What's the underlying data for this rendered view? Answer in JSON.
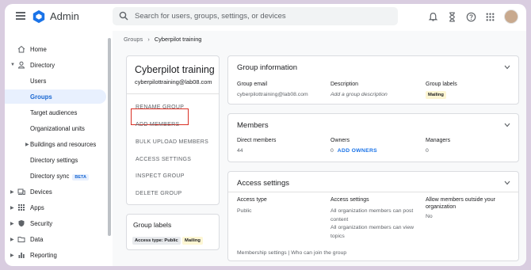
{
  "header": {
    "app_title": "Admin",
    "search_placeholder": "Search for users, groups, settings, or devices",
    "icons": [
      "menu-icon",
      "admin-logo-icon",
      "search-icon",
      "notifications-icon",
      "tasks-hourglass-icon",
      "help-icon",
      "apps-grid-icon",
      "avatar"
    ]
  },
  "sidebar": {
    "items": [
      {
        "label": "Home",
        "icon": "home-icon"
      },
      {
        "label": "Directory",
        "icon": "person-icon"
      },
      {
        "label": "Users"
      },
      {
        "label": "Groups",
        "active": true
      },
      {
        "label": "Target audiences"
      },
      {
        "label": "Organizational units"
      },
      {
        "label": "Buildings and resources"
      },
      {
        "label": "Directory settings"
      },
      {
        "label": "Directory sync",
        "badge": "BETA"
      },
      {
        "label": "Devices",
        "icon": "devices-icon"
      },
      {
        "label": "Apps",
        "icon": "apps-icon"
      },
      {
        "label": "Security",
        "icon": "security-shield-icon"
      },
      {
        "label": "Data",
        "icon": "folder-icon"
      },
      {
        "label": "Reporting",
        "icon": "reporting-bar-chart-icon"
      }
    ]
  },
  "breadcrumb": {
    "parent": "Groups",
    "separator": "›",
    "current": "Cyberpilot training"
  },
  "group": {
    "name": "Cyberpilot training",
    "email": "cyberpilottraining@lab08.com",
    "actions": [
      "RENAME GROUP",
      "ADD MEMBERS",
      "BULK UPLOAD MEMBERS",
      "ACCESS SETTINGS",
      "INSPECT GROUP",
      "DELETE GROUP"
    ],
    "highlighted_action": "ADD MEMBERS"
  },
  "group_labels_card": {
    "title": "Group labels",
    "chips": [
      "Access type: Public",
      "Mailing"
    ]
  },
  "group_information": {
    "title": "Group information",
    "email_label": "Group email",
    "email_value": "cyberpilottraining@lab08.com",
    "description_label": "Description",
    "description_value": "Add a group description",
    "labels_label": "Group labels",
    "labels_value": "Mailing"
  },
  "members": {
    "title": "Members",
    "direct_label": "Direct members",
    "direct_value": "44",
    "owners_label": "Owners",
    "owners_value": "0",
    "add_owners": "ADD OWNERS",
    "managers_label": "Managers",
    "managers_value": "0"
  },
  "access_settings": {
    "title": "Access settings",
    "type_label": "Access type",
    "type_value": "Public",
    "settings_label": "Access settings",
    "settings_line1": "All organization members can post",
    "settings_line2": "content",
    "settings_line3": "All organization members can view",
    "settings_line4": "topics",
    "outside_label_1": "Allow members outside your",
    "outside_label_2": "organization",
    "outside_value": "No",
    "footer": "Membership settings | Who can join the group"
  },
  "colors": {
    "accent": "#1a73e8",
    "highlight_border": "#d93025",
    "active_bg": "#e8f0fe",
    "mailing_chip": "#fdf6d3"
  }
}
